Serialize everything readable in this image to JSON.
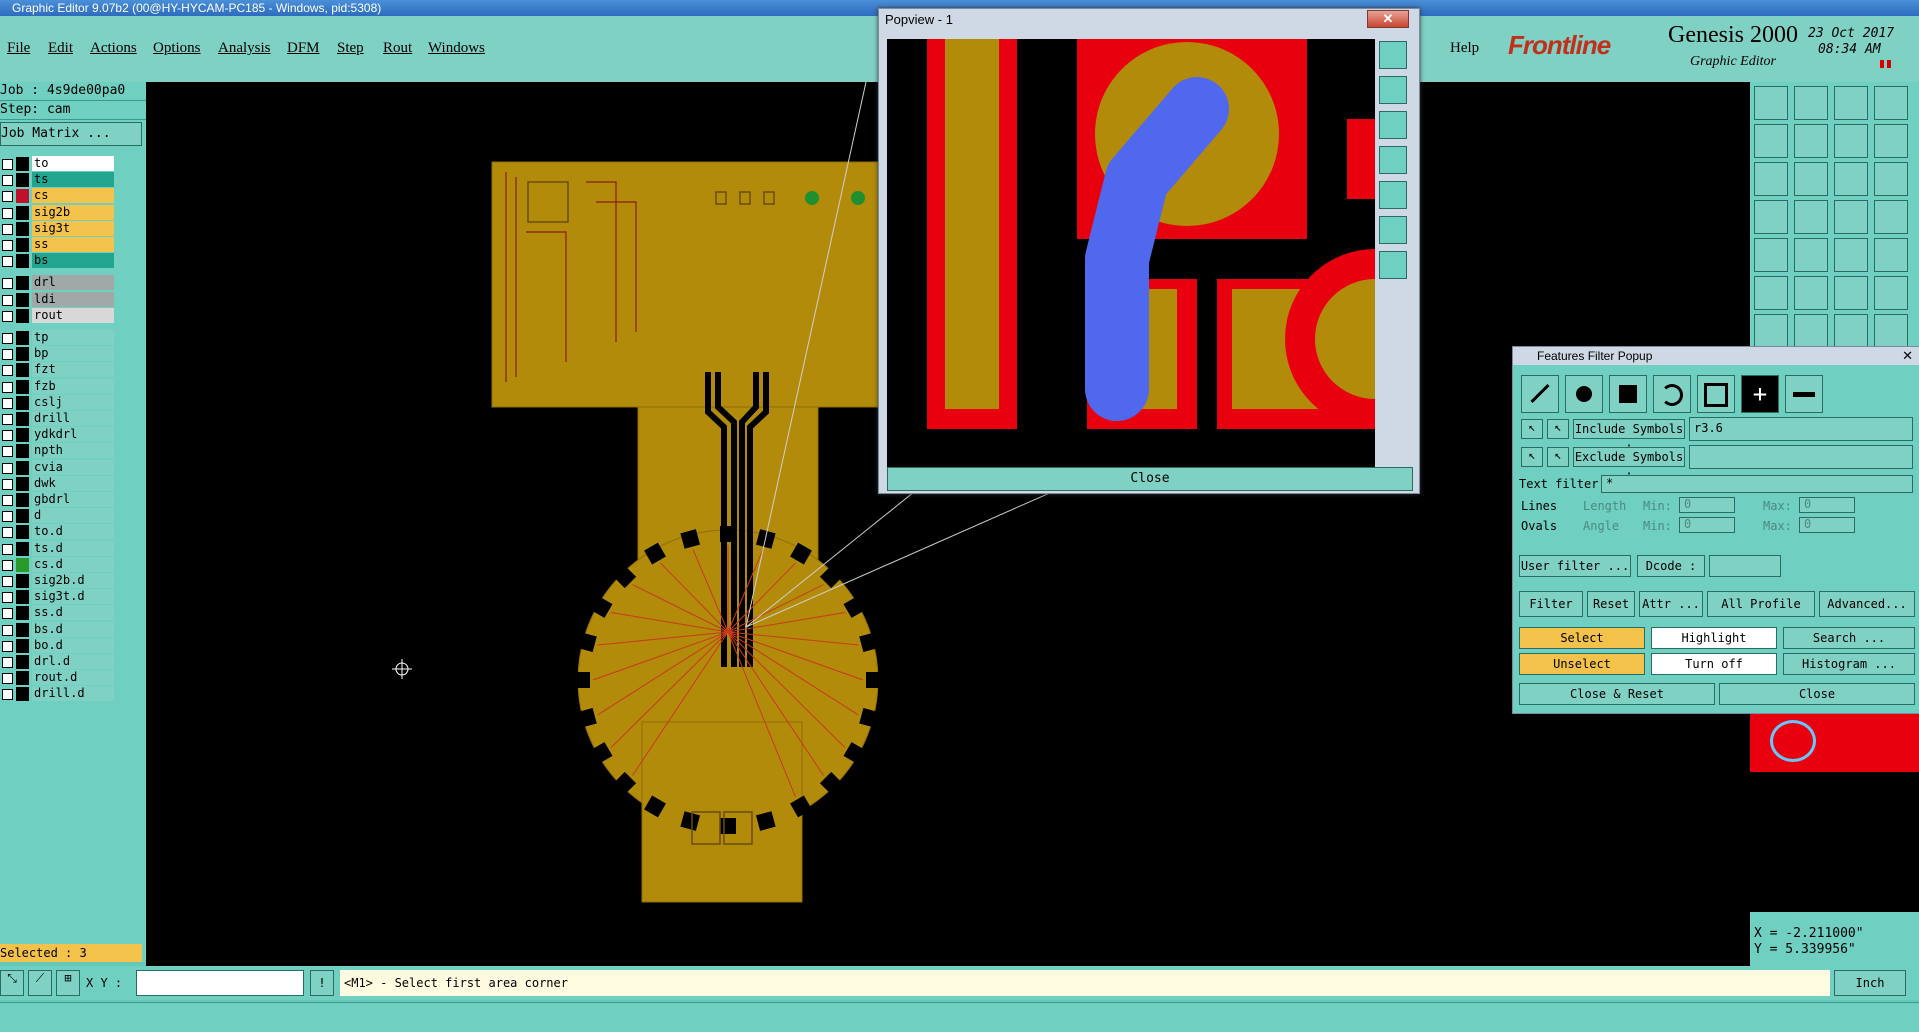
{
  "window": {
    "title": "Graphic Editor 9.07b2 (00@HY-HYCAM-PC185 - Windows, pid:5308)"
  },
  "menu": {
    "items": [
      "File",
      "Edit",
      "Actions",
      "Options",
      "Analysis",
      "DFM",
      "Step",
      "Rout",
      "Windows"
    ],
    "help": "Help"
  },
  "brand": {
    "logo": "Frontline",
    "product": "Genesis 2000",
    "subtitle": "Graphic Editor",
    "date": "23 Oct 2017",
    "time": "08:34 AM"
  },
  "left": {
    "job": "Job : 4s9de00pa0",
    "step": "Step: cam",
    "job_matrix": "Job Matrix ...",
    "selected": "Selected : 3",
    "layers": [
      {
        "name": "to",
        "color": "#ffffff"
      },
      {
        "name": "ts",
        "color": "#21a58f"
      },
      {
        "name": "cs",
        "color": "#f2c24a"
      },
      {
        "name": "sig2b",
        "color": "#f2c24a"
      },
      {
        "name": "sig3t",
        "color": "#f2c24a"
      },
      {
        "name": "ss",
        "color": "#f2c24a"
      },
      {
        "name": "bs",
        "color": "#21a58f"
      },
      {
        "name": "drl",
        "color": "#a0a8a8"
      },
      {
        "name": "ldi",
        "color": "#a0a8a8"
      },
      {
        "name": "rout",
        "color": "#d8d8d8"
      },
      {
        "name": "tp",
        "color": "#7fd1c4"
      },
      {
        "name": "bp",
        "color": "#7fd1c4"
      },
      {
        "name": "fzt",
        "color": "#7fd1c4"
      },
      {
        "name": "fzb",
        "color": "#7fd1c4"
      },
      {
        "name": "cslj",
        "color": "#7fd1c4"
      },
      {
        "name": "drill",
        "color": "#7fd1c4"
      },
      {
        "name": "ydkdrl",
        "color": "#7fd1c4"
      },
      {
        "name": "npth",
        "color": "#7fd1c4"
      },
      {
        "name": "cvia",
        "color": "#7fd1c4"
      },
      {
        "name": "dwk",
        "color": "#7fd1c4"
      },
      {
        "name": "gbdrl",
        "color": "#7fd1c4"
      },
      {
        "name": "d",
        "color": "#7fd1c4"
      },
      {
        "name": "to.d",
        "color": "#7fd1c4"
      },
      {
        "name": "ts.d",
        "color": "#7fd1c4"
      },
      {
        "name": "cs.d",
        "color": "#7fd1c4"
      },
      {
        "name": "sig2b.d",
        "color": "#7fd1c4"
      },
      {
        "name": "sig3t.d",
        "color": "#7fd1c4"
      },
      {
        "name": "ss.d",
        "color": "#7fd1c4"
      },
      {
        "name": "bs.d",
        "color": "#7fd1c4"
      },
      {
        "name": "bo.d",
        "color": "#7fd1c4"
      },
      {
        "name": "drl.d",
        "color": "#7fd1c4"
      },
      {
        "name": "rout.d",
        "color": "#7fd1c4"
      },
      {
        "name": "drill.d",
        "color": "#7fd1c4"
      }
    ]
  },
  "popview": {
    "title": "Popview - 1",
    "close": "Close"
  },
  "filter": {
    "title": "Features Filter Popup",
    "include_label": "Include Symbols :",
    "include_value": "r3.6",
    "exclude_label": "Exclude Symbols :",
    "exclude_value": "",
    "text_filter_label": "Text filter",
    "text_filter_value": "*",
    "lines": "Lines",
    "ovals": "Ovals",
    "length": "Length",
    "angle": "Angle",
    "min": "Min:",
    "max": "Max:",
    "zero": "0",
    "user_filter": "User filter ...",
    "dcode": "Dcode :",
    "filter_chk": "Filter",
    "reset": "Reset",
    "attr": "Attr ...",
    "all_profile": "All Profile",
    "advanced": "Advanced...",
    "select": "Select",
    "highlight": "Highlight",
    "search": "Search ...",
    "unselect": "Unselect",
    "turn_off": "Turn off",
    "histogram": "Histogram ...",
    "close_reset": "Close & Reset",
    "close": "Close"
  },
  "coords": {
    "x": "X = -2.211000\"",
    "y": "Y = 5.339956\""
  },
  "status": {
    "xy_label": "X Y :",
    "message": "<M1> - Select first area corner",
    "units": "Inch"
  }
}
